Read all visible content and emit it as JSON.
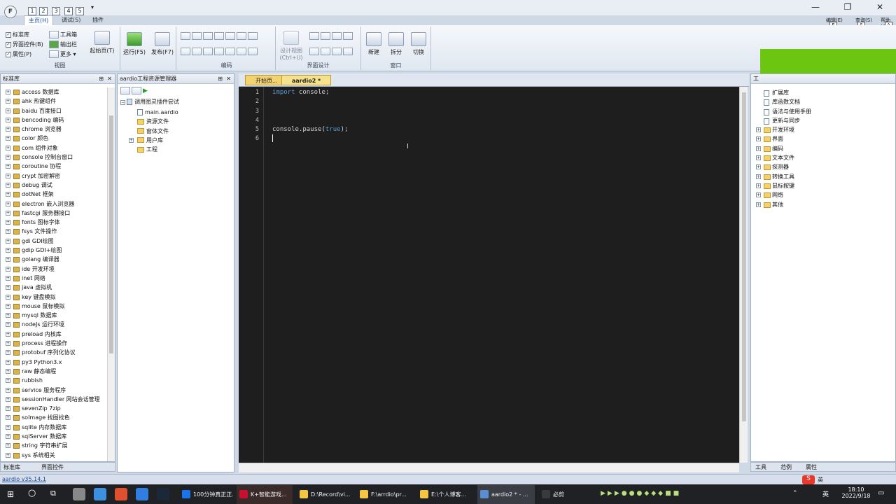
{
  "titlebar": {
    "app_icon": "F",
    "qa_tips": [
      "1",
      "2",
      "3",
      "4",
      "5"
    ],
    "dropdown": "▾",
    "minimize": "—",
    "restore": "❐",
    "close": "✕",
    "right_labels": [
      "编辑(E)",
      "查询(S)",
      "帮助(A)"
    ],
    "right_keytips": [
      "E",
      "S",
      "A"
    ]
  },
  "ribbon": {
    "tabs": [
      "主页(H)",
      "调试(S)",
      "插件"
    ],
    "view_group": {
      "label": "视图",
      "items": [
        "标准库",
        "界面控件(B)",
        "属性(P)",
        "工具箱",
        "输出栏",
        "更多"
      ],
      "checks": [
        "✓",
        "✓",
        "✓"
      ],
      "start_page": "起始页(T)"
    },
    "run_group": {
      "run": "运行(F5)",
      "publish": "发布(F7)"
    },
    "code_group": {
      "label": "编码"
    },
    "design_group": {
      "label": "界面设计",
      "design_view": "设计视图",
      "design_shortcut": "(Ctrl+U)"
    },
    "window_group": {
      "label": "窗口",
      "new": "新建",
      "split": "拆分",
      "switch": "切换"
    }
  },
  "left_panel": {
    "title": "标准库",
    "pin": "⊞",
    "close": "✕",
    "items": [
      "access 数据库",
      "ahk 热键组件",
      "baidu 百度接口",
      "bencoding 编码",
      "chrome 浏览器",
      "color 颜色",
      "com 组件对象",
      "console 控制台窗口",
      "coroutine 协程",
      "crypt 加密解密",
      "debug 调试",
      "dotNet 框架",
      "electron 嵌入浏览器",
      "fastcgi 服务器接口",
      "fonts 图标字体",
      "fsys 文件操作",
      "gdi GDI绘图",
      "gdip GDI+绘图",
      "golang 编译器",
      "ide 开发环境",
      "inet 网络",
      "java 虚拟机",
      "key 键盘模拟",
      "mouse 鼠标模拟",
      "mysql 数据库",
      "nodeJs 运行环境",
      "preload 内核库",
      "process 进程操作",
      "protobuf 序列化协议",
      "py3 Python3.x",
      "raw 静态编程",
      "rubbish",
      "service 服务程序",
      "sessionHandler 网站会话管理",
      "sevenZip 7zip",
      "soImage 找图找色",
      "sqlite 内存数据库",
      "sqlServer 数据库",
      "string 字符串扩展",
      "sys 系统相关"
    ],
    "bottom_tabs": [
      "标准库",
      "界面控件"
    ]
  },
  "project_panel": {
    "title": "aardio工程资源管理器",
    "pin": "⊞",
    "close": "✕",
    "root": "调用图灵插件尝试",
    "items": [
      {
        "label": "main.aardio",
        "type": "file"
      },
      {
        "label": "资源文件",
        "type": "folder"
      },
      {
        "label": "窗体文件",
        "type": "folder"
      },
      {
        "label": "用户库",
        "type": "folder"
      },
      {
        "label": "工程",
        "type": "folder"
      }
    ]
  },
  "editor": {
    "tabs": [
      "开始页...",
      "aardio2 *"
    ],
    "line_numbers": [
      "1",
      "2",
      "3",
      "4",
      "5",
      "6"
    ],
    "code": [
      {
        "kw": "import",
        "rest": " console;"
      },
      {
        "kw": "",
        "rest": ""
      },
      {
        "kw": "",
        "rest": ""
      },
      {
        "kw": "",
        "rest": ""
      },
      {
        "kw": "",
        "rest": "console.pause(true);"
      },
      {
        "kw": "",
        "rest": ""
      }
    ]
  },
  "right_panel": {
    "title": "工",
    "items": [
      {
        "label": "扩展库",
        "type": "book"
      },
      {
        "label": "库函数文档",
        "type": "book"
      },
      {
        "label": "语法与使用手册",
        "type": "book"
      },
      {
        "label": "更新与同步",
        "type": "book"
      },
      {
        "label": "开发环境",
        "type": "folder"
      },
      {
        "label": "界面",
        "type": "folder"
      },
      {
        "label": "编码",
        "type": "folder"
      },
      {
        "label": "文本文件",
        "type": "folder"
      },
      {
        "label": "探测器",
        "type": "folder"
      },
      {
        "label": "转换工具",
        "type": "folder"
      },
      {
        "label": "鼠标按键",
        "type": "folder"
      },
      {
        "label": "网络",
        "type": "folder"
      },
      {
        "label": "其他",
        "type": "folder"
      }
    ],
    "bottom_tabs": [
      "工具",
      "范例",
      "属性"
    ]
  },
  "statusbar": {
    "version": "aardio v35.14.1"
  },
  "taskbar": {
    "apps": [
      {
        "label": "100分钟真正正...",
        "color": "#1a73e8"
      },
      {
        "label": "K+智能游戏...",
        "color": "#c8102e"
      },
      {
        "label": "D:\\Record\\vi...",
        "color": "#f4c542"
      },
      {
        "label": "F:\\arrdio\\pr...",
        "color": "#f4c542"
      },
      {
        "label": "E:\\个人博客...",
        "color": "#f4c542"
      },
      {
        "label": "aardio2 * - ...",
        "color": "#5a8ed0"
      },
      {
        "label": "必剪",
        "color": "#3a3a3a"
      }
    ],
    "ime": "英",
    "time": "18:10",
    "date": "2022/9/18"
  }
}
